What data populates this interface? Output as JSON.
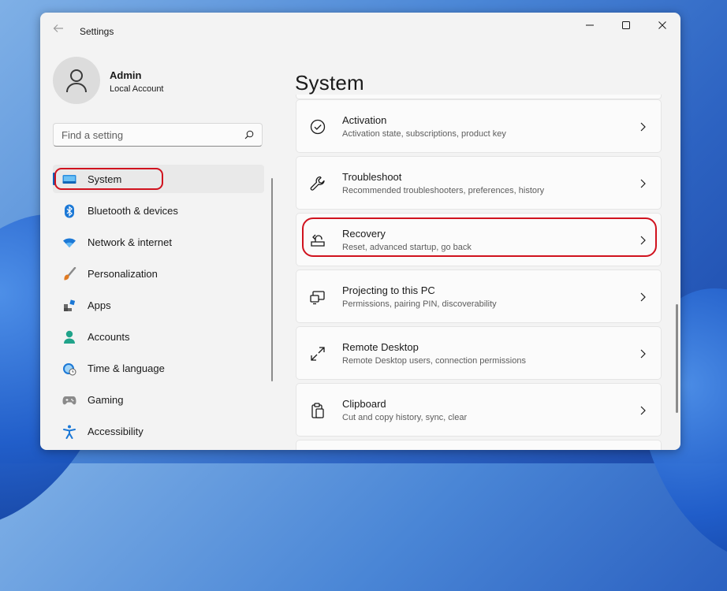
{
  "window": {
    "title": "Settings"
  },
  "profile": {
    "name": "Admin",
    "account_type": "Local Account"
  },
  "search": {
    "placeholder": "Find a setting"
  },
  "sidebar": {
    "items": [
      {
        "label": "System",
        "icon": "system-icon",
        "active": true
      },
      {
        "label": "Bluetooth & devices",
        "icon": "bluetooth-icon"
      },
      {
        "label": "Network & internet",
        "icon": "wifi-icon"
      },
      {
        "label": "Personalization",
        "icon": "brush-icon"
      },
      {
        "label": "Apps",
        "icon": "apps-icon"
      },
      {
        "label": "Accounts",
        "icon": "person-icon"
      },
      {
        "label": "Time & language",
        "icon": "globe-clock-icon"
      },
      {
        "label": "Gaming",
        "icon": "gamepad-icon"
      },
      {
        "label": "Accessibility",
        "icon": "accessibility-icon"
      }
    ]
  },
  "main": {
    "title": "System",
    "cards": [
      {
        "title": "Activation",
        "subtitle": "Activation state, subscriptions, product key",
        "icon": "check-circle-icon"
      },
      {
        "title": "Troubleshoot",
        "subtitle": "Recommended troubleshooters, preferences, history",
        "icon": "wrench-icon"
      },
      {
        "title": "Recovery",
        "subtitle": "Reset, advanced startup, go back",
        "icon": "recovery-icon"
      },
      {
        "title": "Projecting to this PC",
        "subtitle": "Permissions, pairing PIN, discoverability",
        "icon": "projecting-icon"
      },
      {
        "title": "Remote Desktop",
        "subtitle": "Remote Desktop users, connection permissions",
        "icon": "remote-desktop-icon"
      },
      {
        "title": "Clipboard",
        "subtitle": "Cut and copy history, sync, clear",
        "icon": "clipboard-icon"
      }
    ]
  },
  "colors": {
    "accent": "#005fb8",
    "highlight": "#d0121e"
  }
}
